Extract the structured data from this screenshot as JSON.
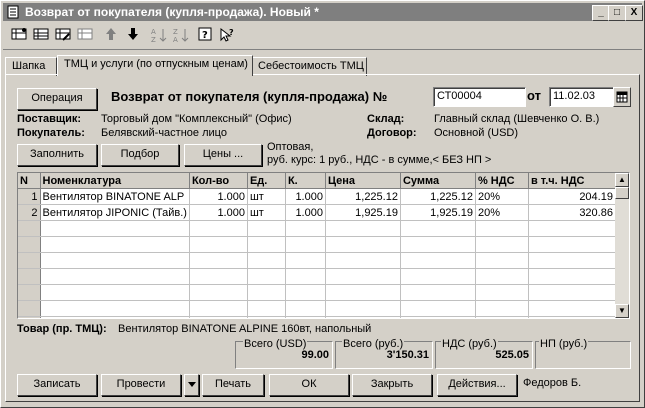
{
  "window": {
    "title": "Возврат от покупателя (купля-продажа). Новый *",
    "controls": [
      "_",
      "□",
      "X"
    ]
  },
  "toolbar": {
    "icons": [
      "new-row-icon",
      "copy-row-icon",
      "edit-row-icon",
      "delete-row-icon",
      "move-up-icon",
      "move-down-icon",
      "sort-asc-icon",
      "sort-desc-icon",
      "help-icon",
      "context-help-icon"
    ]
  },
  "tabs": [
    {
      "label": "Шапка"
    },
    {
      "label": "ТМЦ и услуги (по отпускным ценам)"
    },
    {
      "label": "Себестоимость ТМЦ"
    }
  ],
  "header": {
    "operation_button": "Операция",
    "doc_title": "Возврат от покупателя (купля-продажа) №",
    "doc_number": "СТ00004",
    "date_label": "от",
    "date_value": "11.02.03",
    "supplier_label": "Поставщик:",
    "supplier_value": "Торговый дом \"Комплексный\" (Офис)",
    "buyer_label": "Покупатель:",
    "buyer_value": "Белявский-частное лицо",
    "warehouse_label": "Склад:",
    "warehouse_value": "Главный склад (Шевченко О. В.)",
    "contract_label": "Договор:",
    "contract_value": "Основной (USD)"
  },
  "actions": {
    "fill": "Заполнить",
    "select": "Подбор",
    "prices": "Цены ...",
    "price_info_1": "Оптовая,",
    "price_info_2": "руб. курс: 1 руб., НДС - в сумме,< БЕЗ НП >"
  },
  "table": {
    "columns": [
      "N",
      "Номенклатура",
      "Кол-во",
      "Ед.",
      "К.",
      "Цена",
      "Сумма",
      "% НДС",
      "в т.ч. НДС"
    ],
    "rows": [
      [
        "1",
        "Вентилятор BINATONE ALP",
        "1.000",
        "шт",
        "1.000",
        "1,225.12",
        "1,225.12",
        "20%",
        "204.19"
      ],
      [
        "2",
        "Вентилятор JIPONIC (Тайв.)",
        "1.000",
        "шт",
        "1.000",
        "1,925.19",
        "1,925.19",
        "20%",
        "320.86"
      ]
    ]
  },
  "item_info": {
    "label": "Товар (пр. ТМЦ):",
    "value": "Вентилятор BINATONE ALPINE 160вт, напольный"
  },
  "totals": {
    "usd_label": "Всего (USD)",
    "usd_value": "99.00",
    "rub_label": "Всего (руб.)",
    "rub_value": "3'150.31",
    "vat_label": "НДС (руб.)",
    "vat_value": "525.05",
    "np_label": "НП (руб.)",
    "np_value": ""
  },
  "footer": {
    "save": "Записать",
    "post": "Провести",
    "print": "Печать",
    "ok": "ОК",
    "close": "Закрыть",
    "actions": "Действия...",
    "user": "Федоров Б."
  }
}
